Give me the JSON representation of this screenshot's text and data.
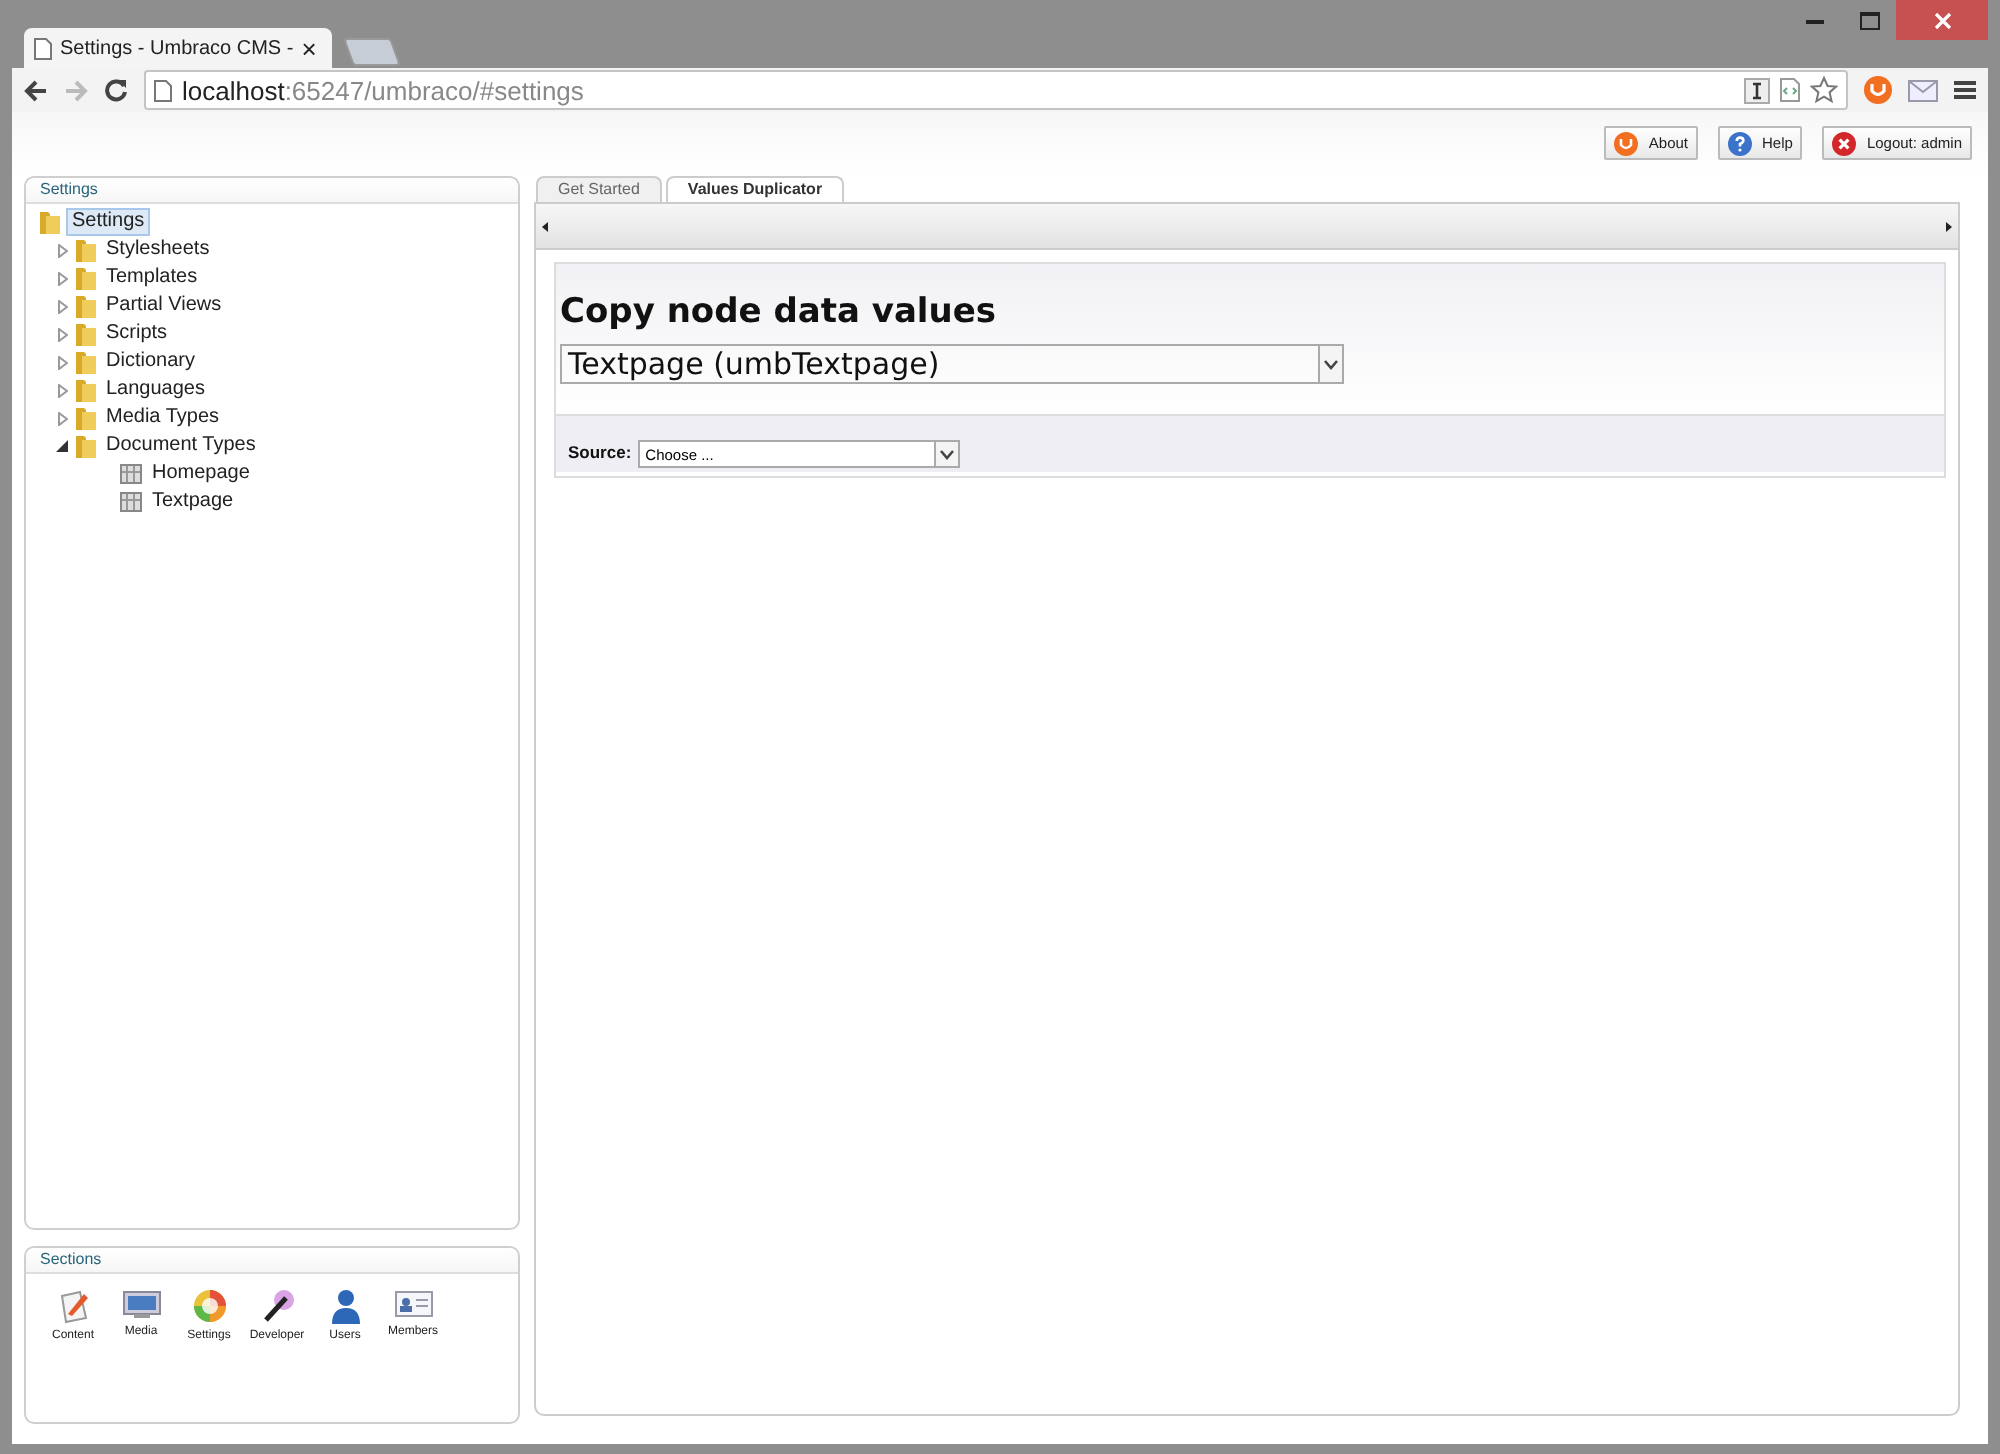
{
  "browser": {
    "tab_title": "Settings - Umbraco CMS -",
    "tab_close": "×",
    "url_host": "localhost",
    "url_path": ":65247/umbraco/#settings"
  },
  "header_buttons": [
    {
      "label": "About",
      "kind": "about"
    },
    {
      "label": "Help",
      "kind": "help"
    },
    {
      "label": "Logout: admin",
      "kind": "logout"
    }
  ],
  "tree": {
    "title": "Settings",
    "root": {
      "label": "Settings",
      "selected": true,
      "children": [
        {
          "label": "Stylesheets",
          "kind": "folder",
          "selected": false,
          "expanded": false
        },
        {
          "label": "Templates",
          "kind": "folder",
          "selected": false,
          "expanded": false
        },
        {
          "label": "Partial Views",
          "kind": "folder",
          "selected": false,
          "expanded": false
        },
        {
          "label": "Scripts",
          "kind": "folder",
          "selected": false,
          "expanded": false
        },
        {
          "label": "Dictionary",
          "kind": "folder",
          "selected": false,
          "expanded": false
        },
        {
          "label": "Languages",
          "kind": "folder",
          "selected": false,
          "expanded": false
        },
        {
          "label": "Media Types",
          "kind": "folder",
          "selected": false,
          "expanded": false
        },
        {
          "label": "Document Types",
          "kind": "folder",
          "selected": false,
          "expanded": true,
          "children": [
            {
              "label": "Homepage",
              "kind": "doctype",
              "selected": false
            },
            {
              "label": "Textpage",
              "kind": "doctype",
              "selected": false
            }
          ]
        }
      ]
    }
  },
  "sections": {
    "title": "Sections",
    "items": [
      {
        "label": "Content",
        "kind": "content"
      },
      {
        "label": "Media",
        "kind": "media"
      },
      {
        "label": "Settings",
        "kind": "settings"
      },
      {
        "label": "Developer",
        "kind": "developer"
      },
      {
        "label": "Users",
        "kind": "users"
      },
      {
        "label": "Members",
        "kind": "members"
      }
    ]
  },
  "tabs": [
    {
      "label": "Get Started",
      "selected": false
    },
    {
      "label": "Values Duplicator",
      "selected": true
    }
  ],
  "panel": {
    "heading": "Copy node data values",
    "doctype_select": {
      "value": "Textpage (umbTextpage)"
    },
    "source": {
      "label": "Source:",
      "value": "Choose ..."
    }
  }
}
